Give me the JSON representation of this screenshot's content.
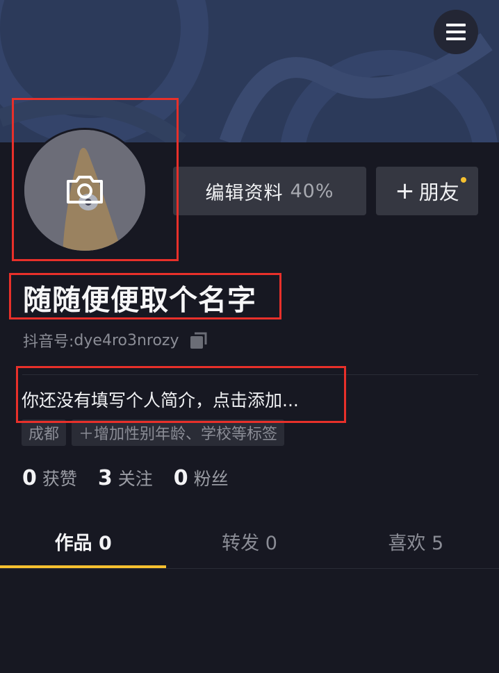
{
  "profile": {
    "edit_label": "编辑资料",
    "edit_percent": "40%",
    "friend_plus": "+",
    "friend_label": "朋友",
    "nickname": "随随便便取个名字",
    "douyin_id_label": "抖音号:",
    "douyin_id": "dye4ro3nrozy",
    "bio": "你还没有填写个人简介，点击添加...",
    "tags": [
      "成都",
      "＋增加性别年龄、学校等标签"
    ]
  },
  "stats": [
    {
      "num": "0",
      "label": "获赞"
    },
    {
      "num": "3",
      "label": "关注"
    },
    {
      "num": "0",
      "label": "粉丝"
    }
  ],
  "tabs": [
    {
      "label": "作品 0",
      "active": true
    },
    {
      "label": "转发 0",
      "active": false
    },
    {
      "label": "喜欢 5",
      "active": false
    }
  ],
  "icons": {
    "menu": "hamburger-menu-icon",
    "camera": "camera-icon",
    "copy": "copy-icon"
  },
  "colors": {
    "background": "#171822",
    "accent": "#f5c02f",
    "highlight": "#e8302a"
  }
}
